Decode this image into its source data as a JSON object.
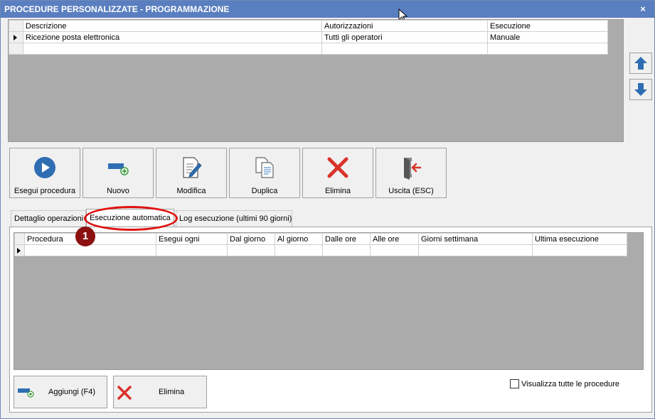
{
  "window": {
    "title": "PROCEDURE PERSONALIZZATE -  PROGRAMMAZIONE",
    "close_glyph": "×"
  },
  "procedures_grid": {
    "columns": [
      "Descrizione",
      "Autorizzazioni",
      "Esecuzione"
    ],
    "rows": [
      {
        "descrizione": "Ricezione posta elettronica",
        "autorizzazioni": "Tutti gli operatori",
        "esecuzione": "Manuale"
      }
    ]
  },
  "side_buttons": {
    "up_icon": "arrow-up-icon",
    "down_icon": "arrow-down-icon"
  },
  "toolbar": {
    "run_label": "Esegui procedura",
    "new_label": "Nuovo",
    "edit_label": "Modifica",
    "duplicate_label": "Duplica",
    "delete_label": "Elimina",
    "exit_label": "Uscita (ESC)"
  },
  "tabs": [
    {
      "label": "Dettaglio operazioni",
      "active": false
    },
    {
      "label": "Esecuzione automatica",
      "active": true
    },
    {
      "label": "Log esecuzione (ultimi 90 giorni)",
      "active": false
    }
  ],
  "annotation": {
    "badge": "1"
  },
  "schedule_grid": {
    "columns": [
      "Procedura",
      "Esegui ogni",
      "Dal giorno",
      "Al giorno",
      "Dalle ore",
      "Alle ore",
      "Giorni settimana",
      "Ultima esecuzione"
    ]
  },
  "bottom": {
    "add_label": "Aggiungi (F4)",
    "delete_label": "Elimina",
    "show_all_label": "Visualizza tutte le procedure"
  },
  "colors": {
    "titlebar": "#5a7fc0",
    "accent_blue": "#2f6db3",
    "delete_red": "#d9332a",
    "annotation_red": "#e01010",
    "badge_dark_red": "#8b1010"
  }
}
